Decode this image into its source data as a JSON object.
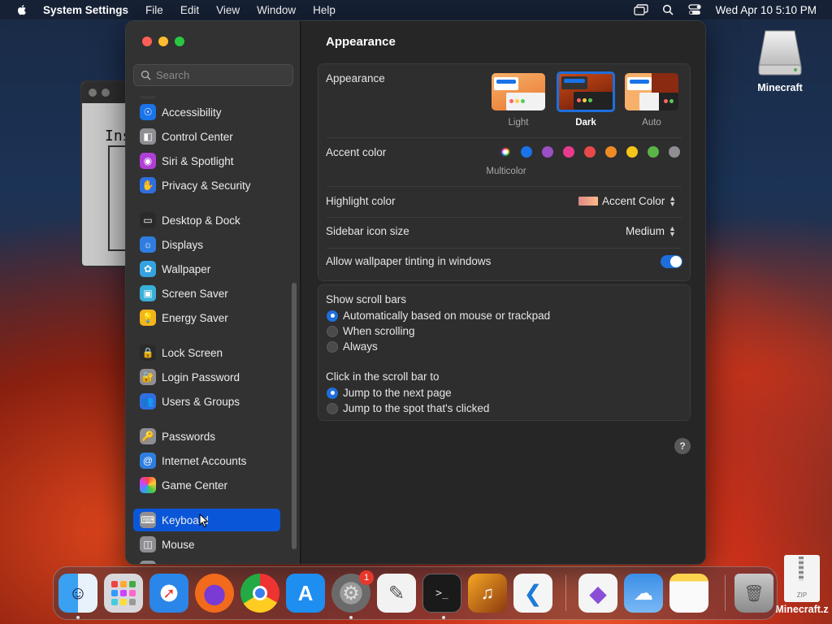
{
  "menubar": {
    "app_name": "System Settings",
    "items": [
      "File",
      "Edit",
      "View",
      "Window",
      "Help"
    ],
    "clock": "Wed Apr 10  5:10 PM"
  },
  "desktop": {
    "drive_label": "Minecraft",
    "zip_label": "Minecraft.z",
    "zip_badge": "ZIP",
    "bg_window_text": "Ins"
  },
  "sidebar": {
    "search_placeholder": "Search",
    "items": [
      {
        "label": "Accessibility",
        "icon": "accessibility-icon",
        "color": "#1a73e8"
      },
      {
        "label": "Control Center",
        "icon": "control-center-icon",
        "color": "#8e8e93"
      },
      {
        "label": "Siri & Spotlight",
        "icon": "siri-icon",
        "color": "#b03fd6"
      },
      {
        "label": "Privacy & Security",
        "icon": "hand-icon",
        "color": "#2f6fe0"
      },
      {
        "label": "Desktop & Dock",
        "icon": "dock-icon",
        "color": "#2a2a2a"
      },
      {
        "label": "Displays",
        "icon": "sun-icon",
        "color": "#2f7de0"
      },
      {
        "label": "Wallpaper",
        "icon": "flower-icon",
        "color": "#36a3e0"
      },
      {
        "label": "Screen Saver",
        "icon": "screen-saver-icon",
        "color": "#38b0d8"
      },
      {
        "label": "Energy Saver",
        "icon": "lightbulb-icon",
        "color": "#f2b51c"
      },
      {
        "label": "Lock Screen",
        "icon": "lock-icon",
        "color": "#2a2a2a"
      },
      {
        "label": "Login Password",
        "icon": "padlock-icon",
        "color": "#8e8e93"
      },
      {
        "label": "Users & Groups",
        "icon": "users-icon",
        "color": "#2f6fe0"
      },
      {
        "label": "Passwords",
        "icon": "key-icon",
        "color": "#8e8e93"
      },
      {
        "label": "Internet Accounts",
        "icon": "at-icon",
        "color": "#2f7de0"
      },
      {
        "label": "Game Center",
        "icon": "game-center-icon",
        "color": "#f2f2f2"
      },
      {
        "label": "Keyboard",
        "icon": "keyboard-icon",
        "color": "#8e8e93"
      },
      {
        "label": "Mouse",
        "icon": "mouse-icon",
        "color": "#8e8e93"
      }
    ],
    "active_item": "Keyboard"
  },
  "main": {
    "title": "Appearance",
    "appearance": {
      "label": "Appearance",
      "options": [
        "Light",
        "Dark",
        "Auto"
      ],
      "selected": "Dark"
    },
    "accent": {
      "label": "Accent color",
      "selected_name": "Multicolor",
      "colors": [
        "multicolor",
        "#1a73e8",
        "#9b4fc4",
        "#e83a8e",
        "#e84a4a",
        "#f08a24",
        "#f5c518",
        "#5ab446",
        "#8e8e93"
      ]
    },
    "highlight": {
      "label": "Highlight color",
      "value": "Accent Color"
    },
    "sidebar_icon_size": {
      "label": "Sidebar icon size",
      "value": "Medium"
    },
    "wallpaper_tinting": {
      "label": "Allow wallpaper tinting in windows",
      "enabled": true
    },
    "scroll_bars": {
      "label": "Show scroll bars",
      "options": [
        "Automatically based on mouse or trackpad",
        "When scrolling",
        "Always"
      ],
      "selected": "Automatically based on mouse or trackpad"
    },
    "scroll_click": {
      "label": "Click in the scroll bar to",
      "options": [
        "Jump to the next page",
        "Jump to the spot that's clicked"
      ],
      "selected": "Jump to the next page"
    },
    "help": "?"
  },
  "dock": {
    "apps": [
      "Finder",
      "Launchpad",
      "Safari",
      "Firefox",
      "Chrome",
      "App Store",
      "System Settings",
      "TextEdit",
      "Terminal",
      "GarageBand",
      "Visual Studio Code",
      "Visual Studio",
      "Weather",
      "Notes",
      "Trash"
    ],
    "system_settings_badge": "1"
  }
}
